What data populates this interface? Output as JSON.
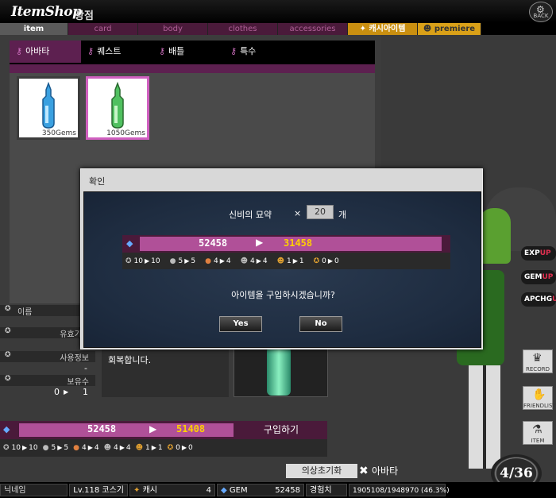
{
  "header": {
    "logo": "ItemShop",
    "subtitle": "상점",
    "back_label": "BACK"
  },
  "category_tabs": [
    {
      "label": "item",
      "active": true
    },
    {
      "label": "card"
    },
    {
      "label": "body"
    },
    {
      "label": "clothes"
    },
    {
      "label": "accessories"
    },
    {
      "label": "캐시아이템"
    },
    {
      "label": "premiere"
    }
  ],
  "sub_tabs": [
    {
      "label": "아바타",
      "active": true
    },
    {
      "label": "퀘스트"
    },
    {
      "label": "배틀"
    },
    {
      "label": "특수"
    }
  ],
  "items": [
    {
      "price": "350Gems",
      "color": "#3aa0e0"
    },
    {
      "price": "1050Gems",
      "color": "#50c060",
      "selected": true
    }
  ],
  "info": {
    "name_label": "이름",
    "validity_label": "유효기간",
    "use_label": "사용정보",
    "use_value": "-",
    "owned_label": "보유수",
    "owned_from": "0",
    "owned_to": "1",
    "description": "회복합니다."
  },
  "purchase": {
    "gem_from": "52458",
    "gem_to": "51408",
    "buy_label": "구입하기"
  },
  "stats": [
    {
      "from": "10",
      "to": "10"
    },
    {
      "from": "5",
      "to": "5"
    },
    {
      "from": "4",
      "to": "4"
    },
    {
      "from": "4",
      "to": "4"
    },
    {
      "from": "1",
      "to": "1"
    },
    {
      "from": "0",
      "to": "0"
    }
  ],
  "bottom_tabs": {
    "reset_label": "의상초기화",
    "avatar_label": "아바타"
  },
  "status_bar": {
    "nickname_label": "닉네임",
    "level": "Lv.118 코스기",
    "cash_label": "캐시",
    "cash_value": "4",
    "gem_label": "GEM",
    "gem_value": "52458",
    "exp_label": "경험치",
    "exp_value": "1905108/1948970 (46.3%)"
  },
  "side": {
    "badges": [
      "EXP",
      "GEM",
      "APCHG"
    ],
    "up_label": "UP",
    "icons": [
      "RECORD",
      "FRIENDLIST",
      "ITEM"
    ],
    "counter": "4/36"
  },
  "modal": {
    "title": "확인",
    "item_name": "신비의 묘약",
    "times": "×",
    "quantity": "20",
    "unit": "개",
    "gem_from": "52458",
    "gem_to": "31458",
    "stats": [
      {
        "from": "10",
        "to": "10"
      },
      {
        "from": "5",
        "to": "5"
      },
      {
        "from": "4",
        "to": "4"
      },
      {
        "from": "4",
        "to": "4"
      },
      {
        "from": "1",
        "to": "1"
      },
      {
        "from": "0",
        "to": "0"
      }
    ],
    "question": "아이템을 구입하시겠습니까?",
    "yes_label": "Yes",
    "no_label": "No"
  }
}
